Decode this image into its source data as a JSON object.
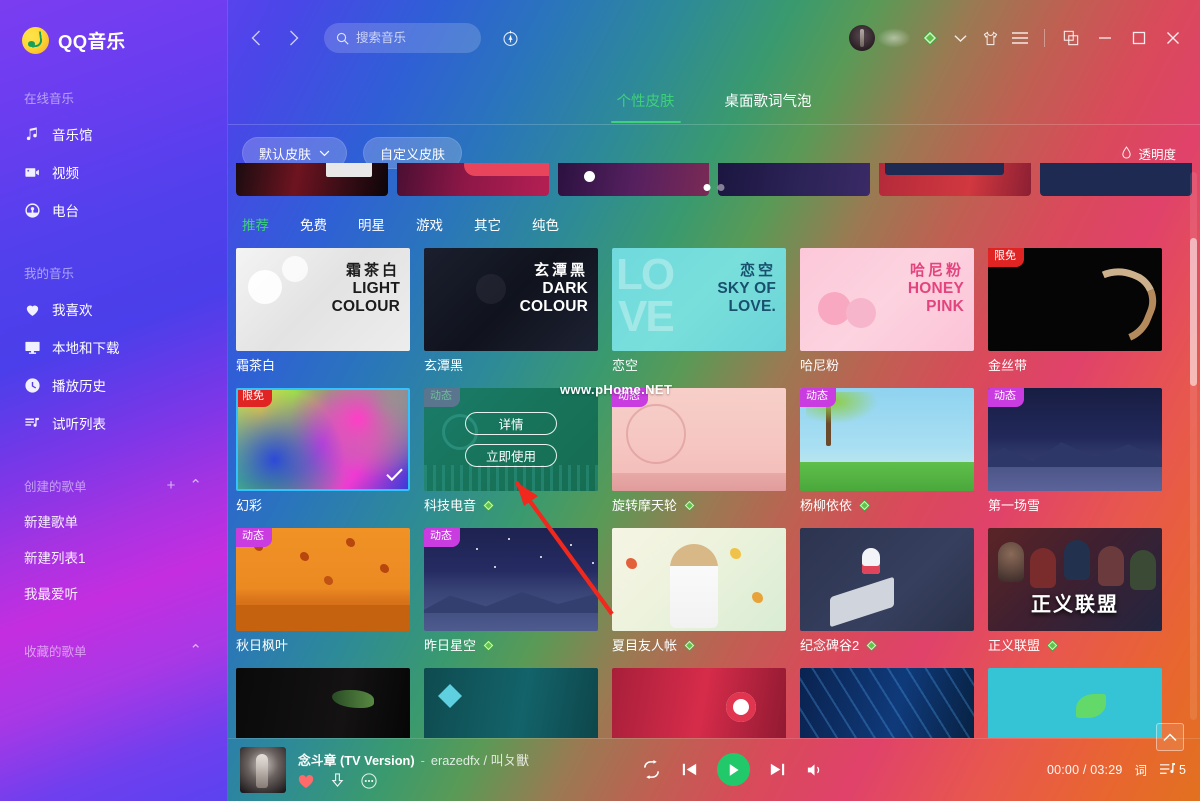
{
  "app": {
    "brand": "QQ音乐",
    "logo_icon": "qq-music-logo"
  },
  "sidebar": {
    "groups": [
      {
        "title": "在线音乐",
        "items": [
          {
            "label": "音乐馆",
            "icon": "music-note-icon"
          },
          {
            "label": "视频",
            "icon": "video-camera-icon"
          },
          {
            "label": "电台",
            "icon": "radio-icon"
          }
        ]
      },
      {
        "title": "我的音乐",
        "items": [
          {
            "label": "我喜欢",
            "icon": "heart-icon"
          },
          {
            "label": "本地和下载",
            "icon": "monitor-icon"
          },
          {
            "label": "播放历史",
            "icon": "clock-icon"
          },
          {
            "label": "试听列表",
            "icon": "playlist-icon"
          }
        ]
      }
    ],
    "created_playlists": {
      "title": "创建的歌单",
      "add_icon": "plus-icon",
      "collapse_icon": "chevron-up-icon",
      "items": [
        {
          "label": "新建歌单"
        },
        {
          "label": "新建列表1"
        },
        {
          "label": "我最爱听"
        }
      ]
    },
    "favorite_playlists": {
      "title": "收藏的歌单",
      "collapse_icon": "chevron-up-icon"
    }
  },
  "titlebar": {
    "back_icon": "chevron-left-icon",
    "forward_icon": "chevron-right-icon",
    "search": {
      "placeholder": "搜索音乐",
      "value": "",
      "icon": "search-icon"
    },
    "discover_icon": "compass-icon",
    "avatar_icon": "user-avatar",
    "vip_icon": "green-diamond-icon",
    "dropdown_icon": "chevron-down-icon",
    "skin_icon": "tshirt-icon",
    "menu_icon": "hamburger-menu-icon",
    "mini_icon": "mini-window-icon",
    "minimize_icon": "minimize-icon",
    "maximize_icon": "maximize-icon",
    "close_icon": "close-icon"
  },
  "tabs": [
    {
      "label": "个性皮肤",
      "active": true
    },
    {
      "label": "桌面歌词气泡",
      "active": false
    }
  ],
  "filterbar": {
    "default_skin": {
      "label": "默认皮肤",
      "icon": "chevron-down-icon"
    },
    "custom_skin": {
      "label": "自定义皮肤"
    },
    "opacity": {
      "label": "透明度",
      "icon": "droplet-icon"
    }
  },
  "banner": {
    "dots": 2,
    "active_dot": 0
  },
  "categories": [
    {
      "label": "推荐",
      "active": true
    },
    {
      "label": "免费",
      "active": false
    },
    {
      "label": "明星",
      "active": false
    },
    {
      "label": "游戏",
      "active": false
    },
    {
      "label": "其它",
      "active": false
    },
    {
      "label": "纯色",
      "active": false
    }
  ],
  "skins": [
    {
      "name": "霜茶白",
      "art_cn": "霜茶白",
      "art_en": "LIGHT\nCOLOUR",
      "art_line1": "LIGHT",
      "art_line2": "COLOUR",
      "badge": "",
      "vip": false,
      "selected": false,
      "hovered": false,
      "thumb": "t-light"
    },
    {
      "name": "玄潭黑",
      "art_cn": "玄潭黑",
      "art_line1": "DARK",
      "art_line2": "COLOUR",
      "badge": "",
      "vip": false,
      "selected": false,
      "hovered": false,
      "thumb": "t-dark"
    },
    {
      "name": "恋空",
      "art_cn": "恋空",
      "art_line1": "SKY OF",
      "art_line2": "LOVE.",
      "badge": "",
      "vip": false,
      "selected": false,
      "hovered": false,
      "thumb": "t-sky"
    },
    {
      "name": "哈尼粉",
      "art_cn": "哈尼粉",
      "art_line1": "HONEY",
      "art_line2": "PINK",
      "badge": "",
      "vip": false,
      "selected": false,
      "hovered": false,
      "thumb": "t-pink"
    },
    {
      "name": "金丝带",
      "art_cn": "",
      "art_line1": "",
      "art_line2": "",
      "badge": "限免",
      "badge_type": "limit",
      "vip": false,
      "selected": false,
      "hovered": false,
      "thumb": "t-gold"
    },
    {
      "name": "幻彩",
      "art_cn": "",
      "art_line1": "",
      "art_line2": "",
      "badge": "限免",
      "badge_type": "limit",
      "vip": false,
      "selected": true,
      "hovered": false,
      "thumb": "t-rainbow"
    },
    {
      "name": "科技电音",
      "art_cn": "",
      "art_line1": "",
      "art_line2": "",
      "badge": "动态",
      "badge_type": "dyn",
      "vip": true,
      "selected": false,
      "hovered": true,
      "thumb": "t-tech"
    },
    {
      "name": "旋转摩天轮",
      "art_cn": "",
      "art_line1": "",
      "art_line2": "",
      "badge": "动态",
      "badge_type": "dyn",
      "vip": true,
      "selected": false,
      "hovered": false,
      "thumb": "t-ferris"
    },
    {
      "name": "杨柳依依",
      "art_cn": "",
      "art_line1": "",
      "art_line2": "",
      "badge": "动态",
      "badge_type": "dyn",
      "vip": true,
      "selected": false,
      "hovered": false,
      "thumb": "t-willow"
    },
    {
      "name": "第一场雪",
      "art_cn": "",
      "art_line1": "",
      "art_line2": "",
      "badge": "动态",
      "badge_type": "dyn",
      "vip": false,
      "selected": false,
      "hovered": false,
      "thumb": "t-snow"
    },
    {
      "name": "秋日枫叶",
      "art_cn": "",
      "art_line1": "",
      "art_line2": "",
      "badge": "动态",
      "badge_type": "dyn",
      "vip": false,
      "selected": false,
      "hovered": false,
      "thumb": "t-autumn"
    },
    {
      "name": "昨日星空",
      "art_cn": "",
      "art_line1": "",
      "art_line2": "",
      "badge": "动态",
      "badge_type": "dyn",
      "vip": true,
      "selected": false,
      "hovered": false,
      "thumb": "t-starry"
    },
    {
      "name": "夏目友人帐",
      "art_cn": "",
      "art_line1": "",
      "art_line2": "",
      "badge": "",
      "vip": true,
      "selected": false,
      "hovered": false,
      "thumb": "t-natsume"
    },
    {
      "name": "纪念碑谷2",
      "art_cn": "",
      "art_line1": "",
      "art_line2": "",
      "badge": "",
      "vip": true,
      "selected": false,
      "hovered": false,
      "thumb": "t-monument"
    },
    {
      "name": "正义联盟",
      "art_cn": "",
      "art_line1": "",
      "art_line2": "",
      "badge": "",
      "vip": true,
      "selected": false,
      "hovered": false,
      "thumb": "t-justice"
    }
  ],
  "hover_card": {
    "detail_label": "详情",
    "apply_label": "立即使用"
  },
  "to_top": {
    "icon": "chevron-up-icon"
  },
  "watermark": "www.pHome.NET",
  "player": {
    "cover_icon": "album-cover",
    "song_title": "念斗章 (TV Version)",
    "separator": "-",
    "artist": "erazedfx / 叫ㄆ獸",
    "like_icon": "heart-filled-icon",
    "download_icon": "download-icon",
    "more_icon": "more-dots-icon",
    "repeat_icon": "repeat-icon",
    "prev_icon": "previous-track-icon",
    "play_icon": "play-icon",
    "next_icon": "next-track-icon",
    "volume_icon": "volume-icon",
    "current_time": "00:00",
    "total_time": "03:29",
    "time_display": "00:00 / 03:29",
    "lyrics_label": "词",
    "queue_icon": "queue-list-icon",
    "queue_count": "5"
  }
}
